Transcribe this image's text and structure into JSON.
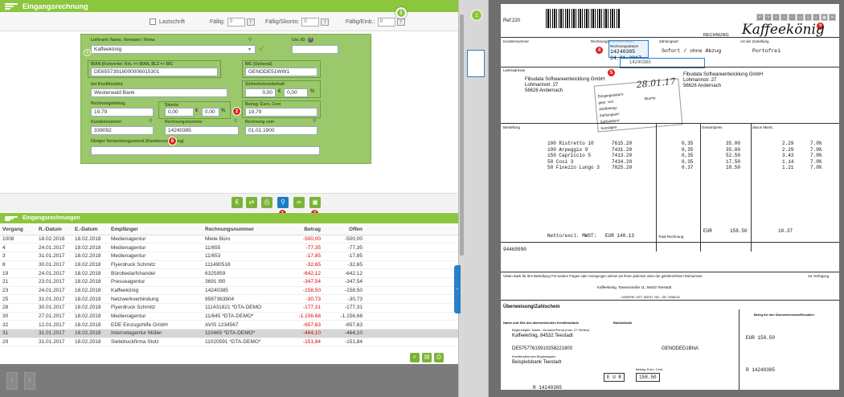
{
  "header": {
    "title": "Eingangsrechnung"
  },
  "filters": {
    "lastschrift_label": "Lastschrift",
    "faellig_label": "Fällig:",
    "faellig_value": "0",
    "faellig_skonto_label": "Fällig/Skonto:",
    "faellig_skonto_value": "0",
    "faellig_einb_label": "Fällig/Einb.:",
    "faellig_einb_value": "0",
    "cal_badge": "7"
  },
  "form": {
    "lieferant_label": "Lieferant: Name, Vorname / Firma",
    "lieferant_value": "Kaffeekönig",
    "ustid_label": "Ust.-ID:",
    "ustid_value": "",
    "iban_label": "IBAN (Konverter: Ktn. => IBAN, BLZ => BIC",
    "iban_value": "DE65573918000006015301",
    "bic_label": "BIC (Optional)",
    "bic_value": "GENODE51WW1",
    "kreditinstitut_label": "bei Kreditinstitut",
    "kreditinstitut_value": "Westerwald Bank",
    "sicherheit_label": "Sicherheitseinbehalt",
    "sicherheit_value1": "0,00",
    "sicherheit_value2": "0,00",
    "betrag_label": "Rechnungsbetrag",
    "betrag_value": "19,79",
    "skonto_label": "Skonto",
    "skonto_value1": "0,00",
    "skonto_value2": "0,00",
    "betrag_euro_label": "Betrag: Euro, Cent",
    "betrag_euro_value": "19,79",
    "kundennummer_label": "Kundennummer",
    "kundennummer_value": "339092",
    "rechnungsnummer_label": "Rechnungsnummer",
    "rechnungsnummer_value": "14240385",
    "rechnung_vom_label": "Rechnung vom",
    "rechnung_vom_value": "01.01.1900",
    "verwendungszweck_label": "Übriger Verwendungszweck (Kundenzuordnung)",
    "verwendungszweck_value": "",
    "euro_symbol": "€",
    "percent_symbol": "%"
  },
  "markers": {
    "m1": "1",
    "m2": "2",
    "m3": "3",
    "m4": "4",
    "m5": "5",
    "m6": "6",
    "m7": "7"
  },
  "list": {
    "title": "Eingangsrechnungen",
    "columns": [
      "Vorgang",
      "R.-Datum",
      "E.-Datum",
      "Empfänger",
      "Rechnungsnummer",
      "Betrag",
      "Offen"
    ],
    "rows": [
      [
        "1008",
        "18.02.2018",
        "18.02.2018",
        "Medienagentur",
        "Miete Büro",
        "-500,00",
        "-500,00"
      ],
      [
        "4",
        "24.01.2017",
        "18.02.2018",
        "Medienagentur",
        "11/655",
        "-77,35",
        "-77,35"
      ],
      [
        "3",
        "31.01.2017",
        "18.02.2018",
        "Medienagentur",
        "11/653",
        "-17,85",
        "-17,85"
      ],
      [
        "8",
        "30.01.2017",
        "18.02.2018",
        "Flyerdruck Schmitz",
        "111490518",
        "-32,65",
        "-32,65"
      ],
      [
        "19",
        "24.01.2017",
        "18.02.2018",
        "Bürobedarfshandel",
        "6325959",
        "-642,12",
        "-642,12"
      ],
      [
        "21",
        "23.01.2017",
        "18.02.2018",
        "Presseagentur",
        "3691 I90",
        "-347,54",
        "-347,54"
      ],
      [
        "23",
        "24.01.2017",
        "18.02.2018",
        "Kaffeekönig",
        "14240385",
        "-158,50",
        "-158,50"
      ],
      [
        "25",
        "31.01.2017",
        "18.02.2018",
        "Netzwerkverbindung",
        "9587363904",
        "-30,73",
        "-30,73"
      ],
      [
        "28",
        "30.01.2017",
        "18.02.2018",
        "Flyerdruck Schmitz",
        "111431821 *DTA-DEMO",
        "-177,31",
        "-177,31"
      ],
      [
        "30",
        "27.01.2017",
        "18.02.2018",
        "Medienagentur",
        "11/645 *DTA-DEMO*",
        "-1.156,68",
        "-1.156,68"
      ],
      [
        "32",
        "12.01.2017",
        "18.02.2018",
        "EDE Einzugshilfe GmbH",
        "AVIS 1234567",
        "-657,63",
        "-657,63"
      ],
      [
        "31",
        "31.01.2017",
        "18.02.2018",
        "Internetagentur Müller",
        "110465 *DTA-DEMO*",
        "-464,10",
        "-464,10"
      ],
      [
        "29",
        "31.01.2017",
        "18.02.2018",
        "Siebdruckfirma Stolz",
        "11020591 *DTA-DEMO*",
        "-151,84",
        "-151,84"
      ]
    ],
    "selected_index": 11
  },
  "document": {
    "ref": "Ref:220",
    "rechnung": "RECHNUNG",
    "logo": "Kaffeekönig",
    "kundennummer_h": "Kundennummer",
    "rechnungsnr_h": "Rechnungsnummer/Datum",
    "zahlungsart_h": "Zahlungsart",
    "zustellung_h": "Art der Zustellung",
    "rechnungsnr_v": "14240385",
    "rechnungsdatum_v": "24.01.2017",
    "zahlungsart_v": "Sofort / ohne Abzug",
    "zustellung_v": "Portofrei",
    "overlay_rechnungsdatum": "Rechnungsdatum",
    "overlay_value": "14240385",
    "lieferadresse_h": "Lieferadresse",
    "lieferadresse": [
      "Fibudata Softwareentwicklung GmbH",
      "Lohmannstr. 27",
      "56626 Andernach"
    ],
    "rechnungsadresse": [
      "Fibudata Softwareentwicklung GmbH",
      "Lohmannstr. 27",
      "56626 Andernach"
    ],
    "stamp_date": "28.01.17",
    "stamp_lines": [
      "Eingangsdatum:",
      "gepr. von:",
      "Zahlbetrag:",
      "Zahlungsart:",
      "Zahlsdatum:",
      "Sonstiges:"
    ],
    "stamp_skonto": "Skonto:",
    "bestellung_h": "Bestellung",
    "gesamtpreis_h": "Gesamtpreis",
    "mwst_h": "davon MwSt.",
    "items": [
      {
        "desc": "100 Ristretto 10",
        "a": "7615.20",
        "b": "0,35",
        "c": "35.00",
        "d": "2.29",
        "e": "7.0%"
      },
      {
        "desc": "100 Arpeggio 9",
        "a": "7431.20",
        "b": "0,35",
        "c": "35.00",
        "d": "2.29",
        "e": "7.0%"
      },
      {
        "desc": "150 Capriccio 5",
        "a": "7413.20",
        "b": "0,35",
        "c": "52.50",
        "d": "3.43",
        "e": "7.0%"
      },
      {
        "desc": "50 Cosi 3",
        "a": "7434.20",
        "b": "0,35",
        "c": "17.50",
        "d": "1.14",
        "e": "7.0%"
      },
      {
        "desc": "50 Finezzo Lungo 3",
        "a": "7825.20",
        "b": "0.37",
        "c": "18.50",
        "d": "1.21",
        "e": "7.0%"
      }
    ],
    "netto_label": "Netto/excl. MWST:",
    "netto_value": "EUR 148.13",
    "total_label": "Total Rechnung",
    "total_cur": "EUR",
    "total_value": "158.50",
    "total_mwst": "10.37",
    "code": "94469990",
    "thanks": "Vielen Dank für Ihre Bestellung! Für weitere Fragen oder Anregungen stehen wir Ihnen jederzeit unter der gebührenfreien Rufnummer",
    "thanks_right": "zur Verfügung.",
    "company_line": "Kaffeekönig, Tassenstraße 11, 84632 Teestadt",
    "ust_line": "UNSERE UST. IDENT. NR.: DE 7458216",
    "ueberweisung_h": "Überweisung/Zahlschein",
    "beleg_h": "Beleg für den Überweisenden/Einzahler",
    "bank_h": "Name und Sitz des überweisenden Kreditinstituts",
    "bankleitzahl_h": "Bankleitzahl",
    "beguenstigter_h": "Begünstigter: Name, Vorname/Firma (max. 27 Stellen)",
    "beguenstigter_v": "Kaffeekönig, 84532 Teestadt",
    "iban_v": "DE57577615910258221800",
    "bic_v": "GENODED1BNA",
    "kreditinstitut_h": "Kreditinstitut des Begünstigten",
    "kreditinstitut_v": "Beispielsbank Teestadt",
    "betrag_h": "Betrag: Euro, Cent",
    "betrag_cur": "E U R",
    "betrag_v": "158.50",
    "beleg_betrag": "EUR 158.50",
    "beleg_ref": "R 14240385",
    "kunden_ref": "R 14240385"
  }
}
